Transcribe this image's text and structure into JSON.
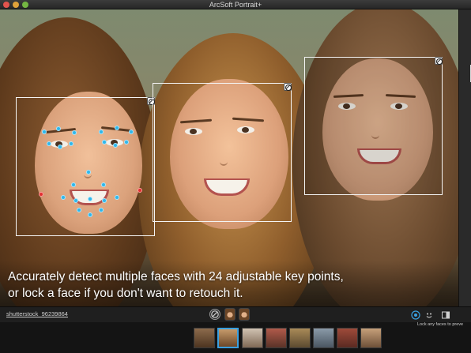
{
  "window": {
    "title": "ArcSoft Portrait+"
  },
  "canvas": {
    "caption_line1": "Accurately detect multiple faces with 24 adjustable key points,",
    "caption_line2": "or lock a face if you don't want to retouch it."
  },
  "status": {
    "filename": "shutterstock_96239864",
    "tooltip": "Lock any faces to preve"
  },
  "icons": {
    "lock": "lock-face-icon",
    "disable": "no-entry-icon",
    "detect": "face-detect-icon",
    "smile": "smile-icon",
    "panel": "panel-toggle-icon"
  },
  "colors": {
    "keypoint": "#2fb7ea",
    "keypoint_warning": "#e03131",
    "selection": "#3aa0e0"
  },
  "filmstrip": {
    "count": 8,
    "selected_index": 1
  }
}
